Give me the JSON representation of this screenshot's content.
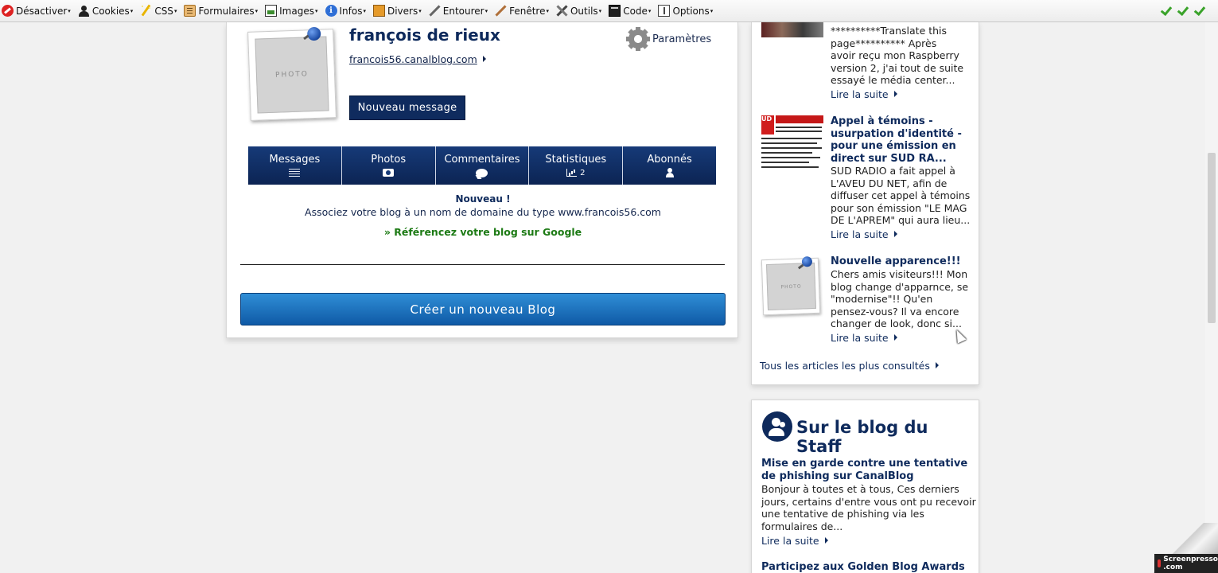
{
  "toolbar": {
    "items": [
      {
        "label": "Désactiver",
        "icon": "stop-icon"
      },
      {
        "label": "Cookies",
        "icon": "person-icon"
      },
      {
        "label": "CSS",
        "icon": "pencil-icon"
      },
      {
        "label": "Formulaires",
        "icon": "clipboard-icon"
      },
      {
        "label": "Images",
        "icon": "image-icon"
      },
      {
        "label": "Infos",
        "icon": "info-icon"
      },
      {
        "label": "Divers",
        "icon": "book-icon"
      },
      {
        "label": "Entourer",
        "icon": "ruler-icon"
      },
      {
        "label": "Fenêtre",
        "icon": "brush-icon"
      },
      {
        "label": "Outils",
        "icon": "tools-icon"
      },
      {
        "label": "Code",
        "icon": "terminal-icon"
      },
      {
        "label": "Options",
        "icon": "options-icon"
      }
    ],
    "arrow": "▾",
    "info_glyph": "i"
  },
  "profile": {
    "name": "françois de rieux",
    "url": "francois56.canalblog.com",
    "photo_label": "PHOTO",
    "settings_label": "Paramètres",
    "new_message_label": "Nouveau message"
  },
  "tabs": [
    {
      "label": "Messages",
      "icon": "list-icon",
      "count": ""
    },
    {
      "label": "Photos",
      "icon": "camera-icon",
      "count": ""
    },
    {
      "label": "Commentaires",
      "icon": "comment-icon",
      "count": ""
    },
    {
      "label": "Statistiques",
      "icon": "stats-icon",
      "count": "2"
    },
    {
      "label": "Abonnés",
      "icon": "user-icon",
      "count": ""
    }
  ],
  "promo": {
    "title": "Nouveau !",
    "text": "Associez votre blog à un nom de domaine du type www.francois56.com",
    "link": "» Référencez votre blog sur Google"
  },
  "create_blog_label": "Créer un nouveau Blog",
  "popular": {
    "articles": [
      {
        "title": "",
        "text_lines": [
          "**********Translate this",
          "page********** Après",
          "avoir reçu mon Raspberry",
          "version 2, j'ai tout de suite",
          "essayé le média center..."
        ],
        "read_more": "Lire la suite"
      },
      {
        "title_lines": [
          "Appel à témoins -",
          "usurpation d'identité -",
          "pour une émission en",
          "direct sur SUD RA..."
        ],
        "text_lines": [
          "SUD RADIO a fait appel à",
          "L'AVEU DU NET, afin de",
          "diffuser cet appel à témoins",
          "pour son émission \"LE MAG",
          "DE L'APREM\" qui aura lieu..."
        ],
        "read_more": "Lire la suite"
      },
      {
        "title_lines": [
          "Nouvelle apparence!!!"
        ],
        "text_lines": [
          "Chers amis visiteurs!!! Mon",
          "blog change d'apparnce, se",
          "\"modernise\"!! Qu'en",
          "pensez-vous? Il va encore",
          "changer de look, donc si..."
        ],
        "read_more": "Lire la suite",
        "photo_label": "PHOTO"
      }
    ],
    "all_link": "Tous les articles les plus consultés"
  },
  "staff": {
    "title": "Sur le blog du Staff",
    "post1_title_lines": [
      "Mise en garde contre une tentative",
      "de phishing sur CanalBlog"
    ],
    "post1_text_lines": [
      "Bonjour à toutes et à tous, Ces derniers",
      "jours, certains d'entre vous ont pu recevoir",
      "une tentative de phishing via les",
      "formulaires de..."
    ],
    "post1_read_more": "Lire la suite",
    "post2_title": "Participez aux Golden Blog Awards"
  },
  "watermark": {
    "line1": "Screenpresso",
    "line2": ".com"
  },
  "colors": {
    "brand_navy": "#0e2a5c",
    "link_green": "#1c7a14",
    "button_blue": "#1a72c0"
  }
}
